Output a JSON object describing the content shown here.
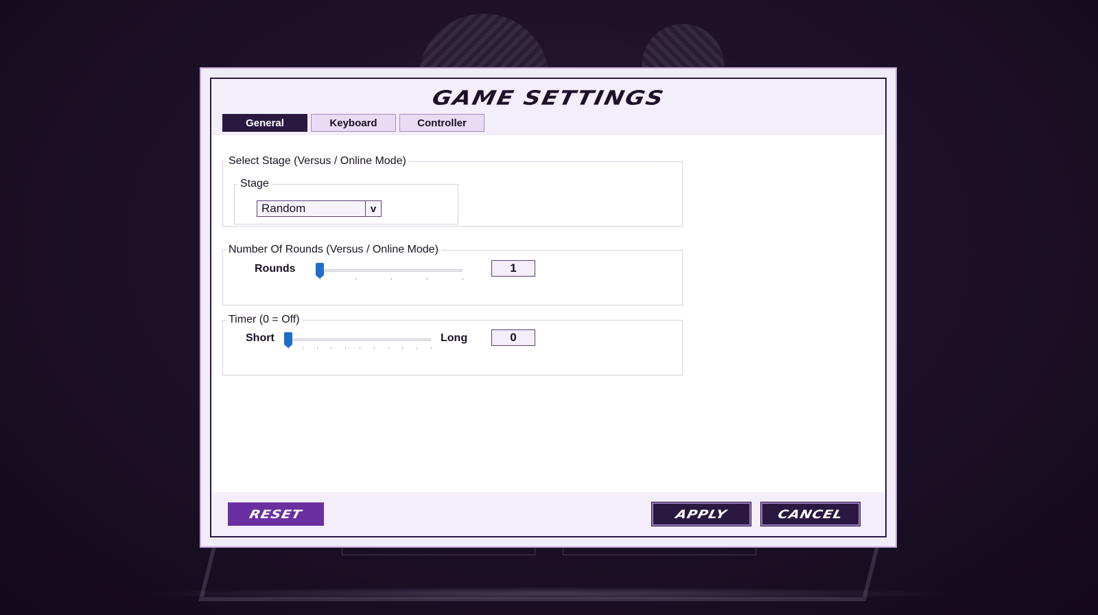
{
  "dialog": {
    "title": "GAME SETTINGS"
  },
  "tabs": [
    {
      "label": "General",
      "active": true
    },
    {
      "label": "Keyboard",
      "active": false
    },
    {
      "label": "Controller",
      "active": false
    }
  ],
  "stage_group": {
    "legend": "Select Stage (Versus / Online Mode)",
    "inner_legend": "Stage",
    "selected": "Random",
    "arrow": "v"
  },
  "rounds_group": {
    "legend": "Number Of Rounds (Versus / Online Mode)",
    "label": "Rounds",
    "value": "1",
    "slider_fraction": 0.0,
    "tick_count": 5
  },
  "timer_group": {
    "legend": "Timer (0 = Off)",
    "min_label": "Short",
    "max_label": "Long",
    "value": "0",
    "slider_fraction": 0.0,
    "tick_count": 11
  },
  "footer": {
    "reset": "RESET",
    "apply": "APPLY",
    "cancel": "CANCEL"
  },
  "colors": {
    "accent_dark": "#2a1840",
    "accent_purple": "#6a2fa0",
    "slider_thumb": "#1e6fc7"
  }
}
